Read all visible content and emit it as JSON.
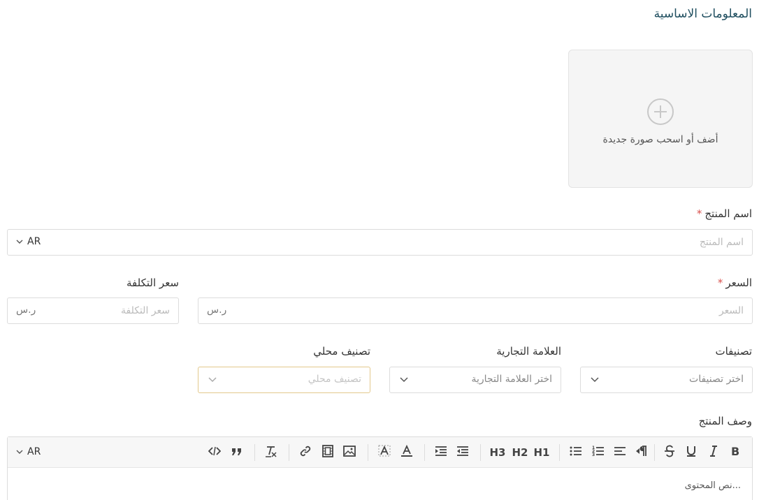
{
  "section": {
    "title": "المعلومات الاساسية"
  },
  "upload": {
    "text": "أضف أو اسحب صورة جديدة",
    "icon": "plus-circle-icon"
  },
  "product_name": {
    "label": "اسم المنتج",
    "required": "*",
    "placeholder": "اسم المنتج",
    "lang": "AR"
  },
  "price": {
    "label": "السعر",
    "required": "*",
    "placeholder": "السعر",
    "currency": "ر.س"
  },
  "cost_price": {
    "label": "سعر التكلفة",
    "placeholder": "سعر التكلفة",
    "currency": "ر.س"
  },
  "categories": {
    "label": "تصنيفات",
    "placeholder": "اختر تصنيفات"
  },
  "brand": {
    "label": "العلامة التجارية",
    "placeholder": "اختر العلامة التجارية"
  },
  "local_category": {
    "label": "تصنيف محلي",
    "placeholder": "تصنيف محلي"
  },
  "description": {
    "label": "وصف المنتج",
    "lang": "AR",
    "content_placeholder": "...نص المحتوى",
    "toolbar": {
      "h1": "H1",
      "h2": "H2",
      "h3": "H3"
    }
  },
  "colors": {
    "title": "#1f4e5f",
    "required": "#d9534f",
    "focus_border": "#e3c98c"
  }
}
